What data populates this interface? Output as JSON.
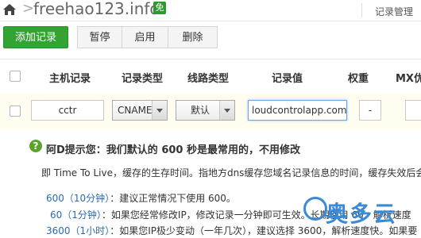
{
  "header": {
    "domain": "freehao123.info",
    "badge": "免",
    "link": "记录管理"
  },
  "toolbar": {
    "add": "添加记录",
    "pause": "暂停",
    "enable": "启用",
    "delete": "删除"
  },
  "table": {
    "columns": [
      "主机记录",
      "记录类型",
      "线路类型",
      "记录值",
      "权重",
      "MX优"
    ],
    "row": {
      "host": "cctr",
      "type": "CNAME",
      "line": "默认",
      "value": "loudcontrolapp.com",
      "weight": "-"
    }
  },
  "tip": {
    "icon": "?",
    "title": "阿D提示您：我们默认的 600 秒是最常用的，不用修改",
    "desc": "即 Time To Live，缓存的生存时间。指地方dns缓存您域名记录信息的时间，缓存失效后会",
    "items": [
      {
        "key": "600（10分钟）",
        "text": "：建议正常情况下使用 600。"
      },
      {
        "key": "60（1分钟）",
        "text": "：如果您经常修改IP，修改记录一分钟即可生效。长期使用 60，解析速度"
      },
      {
        "key": "3600（1小时）",
        "text": "：如果您IP极少变动（一年几次），建议选择 3600，解析速度快。如果要"
      }
    ]
  },
  "watermark": "奥多云"
}
